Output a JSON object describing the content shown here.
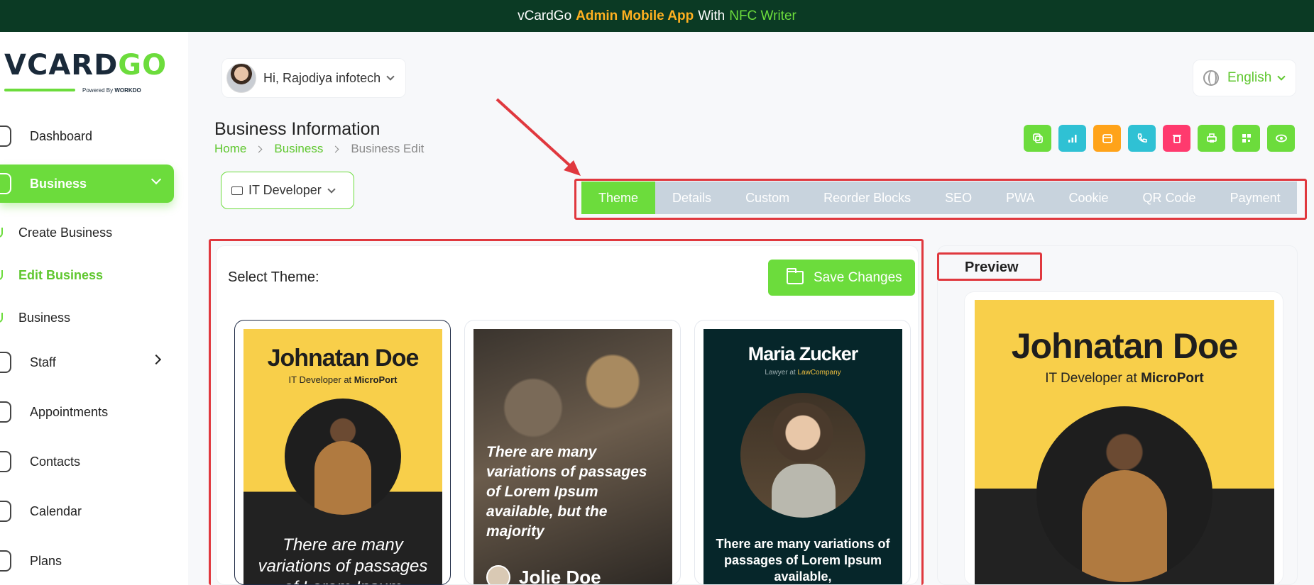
{
  "topbar": {
    "pre": "vCardGo",
    "highlight1": "Admin Mobile App",
    "mid": "With",
    "highlight2": "NFC Writer"
  },
  "logo": {
    "word_a": "VCARD",
    "word_b": "GO",
    "powered": "Powered By",
    "powered_brand": "WORKDO"
  },
  "sidebar": {
    "items": [
      {
        "label": "Dashboard"
      },
      {
        "label": "Business"
      },
      {
        "label": "Staff"
      },
      {
        "label": "Appointments"
      },
      {
        "label": "Contacts"
      },
      {
        "label": "Calendar"
      },
      {
        "label": "Plans"
      }
    ],
    "sub_items": [
      {
        "label": "Create Business"
      },
      {
        "label": "Edit Business"
      },
      {
        "label": "Business"
      }
    ]
  },
  "header": {
    "greeting": "Hi, Rajodiya infotech",
    "language": "English"
  },
  "page": {
    "title": "Business Information",
    "breadcrumb": [
      "Home",
      "Business",
      "Business Edit"
    ],
    "business_select": "IT Developer"
  },
  "actions": [
    {
      "icon": "copy-icon",
      "color": "#6cdc3c"
    },
    {
      "icon": "analytics-icon",
      "color": "#2fc1d4"
    },
    {
      "icon": "calendar-icon",
      "color": "#ffa319"
    },
    {
      "icon": "phone-icon",
      "color": "#2fc1d4"
    },
    {
      "icon": "trash-icon",
      "color": "#ff3a6e"
    },
    {
      "icon": "print-icon",
      "color": "#6cdc3c"
    },
    {
      "icon": "qr-icon",
      "color": "#6cdc3c"
    },
    {
      "icon": "eye-icon",
      "color": "#6cdc3c"
    }
  ],
  "tabs": [
    "Theme",
    "Details",
    "Custom",
    "Reorder Blocks",
    "SEO",
    "PWA",
    "Cookie",
    "QR Code",
    "Payment"
  ],
  "theme_panel": {
    "label": "Select Theme:",
    "save_label": "Save Changes"
  },
  "themes": [
    {
      "name": "Johnatan Doe",
      "role_prefix": "IT Developer at",
      "role_company": "MicroPort",
      "quote": "There are many variations of passages of Lorem Ipsum"
    },
    {
      "quote": "There are many variations of passages of Lorem Ipsum available, but the majority",
      "signature": "Jolie Doe"
    },
    {
      "name": "Maria Zucker",
      "role_prefix": "Lawyer at",
      "role_company": "LawCompany",
      "quote": "There are many variations of passages of Lorem Ipsum available,"
    }
  ],
  "preview": {
    "label": "Preview",
    "name": "Johnatan Doe",
    "role_prefix": "IT Developer at",
    "role_company": "MicroPort"
  },
  "colors": {
    "accent": "#6cdc3c",
    "topbar": "#0b3a24",
    "annotation": "#e0383e",
    "tab_bg": "#c8d3dd"
  }
}
